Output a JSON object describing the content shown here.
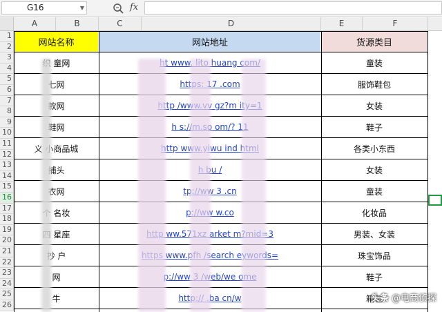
{
  "formula_bar": {
    "name_box": "G16",
    "fx_label": "fx",
    "formula": ""
  },
  "columns": [
    "A",
    "B",
    "C",
    "D",
    "E",
    "F"
  ],
  "rows": [
    "1",
    "2",
    "3",
    "4",
    "5",
    "6",
    "7",
    "8",
    "9",
    "10",
    "11",
    "12",
    "13",
    "14",
    "15",
    "16",
    "17",
    "18",
    "19",
    "20",
    "21",
    "22",
    "23",
    "24",
    "25",
    "26"
  ],
  "active_row": "16",
  "headers": {
    "site_name": "网站名称",
    "site_url": "网站地址",
    "category": "货源类目"
  },
  "table": [
    {
      "name": "织  童网",
      "url": "ht   www.  lito  huang  com/",
      "category": "童装"
    },
    {
      "name": "七网",
      "url": "https:   17   .com",
      "category": "服饰鞋包"
    },
    {
      "name": "款网",
      "url": "http   /www.vv   gz?m  ity=1",
      "category": "女装"
    },
    {
      "name": "鞋网",
      "url": "h  s://m.so   om/?  11",
      "category": "鞋子"
    },
    {
      "name": "义  小商品城",
      "url": "http   www.yiwu   ind  html",
      "category": "各类小东西"
    },
    {
      "name": "捕头",
      "url": "h   bu  /",
      "category": "女装"
    },
    {
      "name": "衣网",
      "url": "tp://ww  3  .cn",
      "category": "童装"
    },
    {
      "name": "个  名妆",
      "url": "p://ww    w.co",
      "category": "化妆品"
    },
    {
      "name": "四  星座",
      "url": "http   ww.571xz   arket  m?mid=3",
      "category": "男装、女装"
    },
    {
      "name": "抄  户",
      "url": "https   www.pfh   /search  eywords=",
      "category": "珠宝饰品"
    },
    {
      "name": "网",
      "url": "p://ww  3  /web/we  ome",
      "category": "鞋子"
    },
    {
      "name": "牛",
      "url": "http://  .ba   cn/w",
      "category": "箱包"
    }
  ],
  "watermark": {
    "brand": "头条",
    "handle": "@电商侦探"
  },
  "colors": {
    "header_name_bg": "#ffff00",
    "header_url_bg": "#c5d9f1",
    "header_category_bg": "#f2dcdb",
    "link": "#2343c8",
    "selection": "#1e9a45"
  }
}
